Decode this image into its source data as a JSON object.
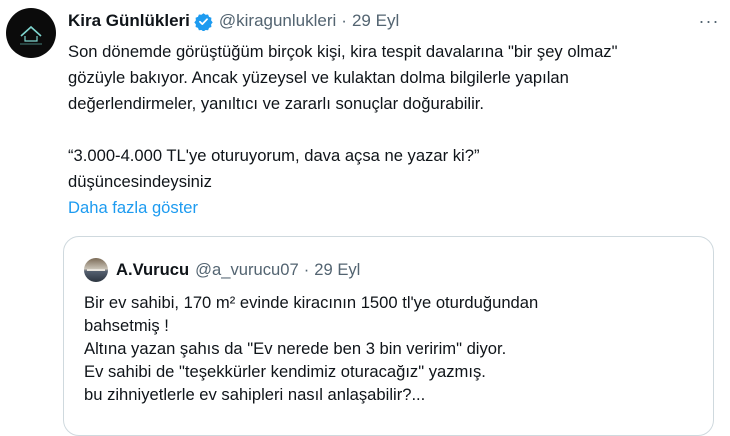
{
  "tweet": {
    "author_name": "Kira Günlükleri",
    "handle": "@kiragunlukleri",
    "separator": "·",
    "date": "29 Eyl",
    "more_label": "···",
    "body_lines": [
      "Son dönemde görüştüğüm birçok kişi, kira tespit davalarına \"bir şey olmaz\"",
      "gözüyle bakıyor. Ancak yüzeysel ve kulaktan dolma bilgilerle yapılan",
      "değerlendirmeler, yanıltıcı ve zararlı sonuçlar doğurabilir."
    ],
    "quote_lines": [
      "“3.000-4.000 TL'ye oturuyorum, dava açsa ne yazar ki?”",
      "düşüncesindeysiniz"
    ],
    "show_more": "Daha fazla göster"
  },
  "quoted": {
    "author_name": "A.Vurucu",
    "handle": "@a_vurucu07",
    "separator": "·",
    "date": "29 Eyl",
    "lines": [
      "Bir ev sahibi, 170 m² evinde kiracının 1500 tl'ye oturduğundan",
      "bahsetmiş !",
      "Altına yazan şahıs da \"Ev nerede ben 3 bin veririm\" diyor.",
      "Ev sahibi de \"teşekkürler kendimiz oturacağız\" yazmış.",
      "bu zihniyetlerle ev sahipleri nasıl anlaşabilir?..."
    ]
  },
  "colors": {
    "text": "#0f1419",
    "secondary": "#536471",
    "link": "#1d9bf0",
    "verified": "#1d9bf0",
    "border": "#cfd9de"
  },
  "icons": {
    "verified": "verified-badge-icon",
    "more": "more-horizontal-icon"
  }
}
